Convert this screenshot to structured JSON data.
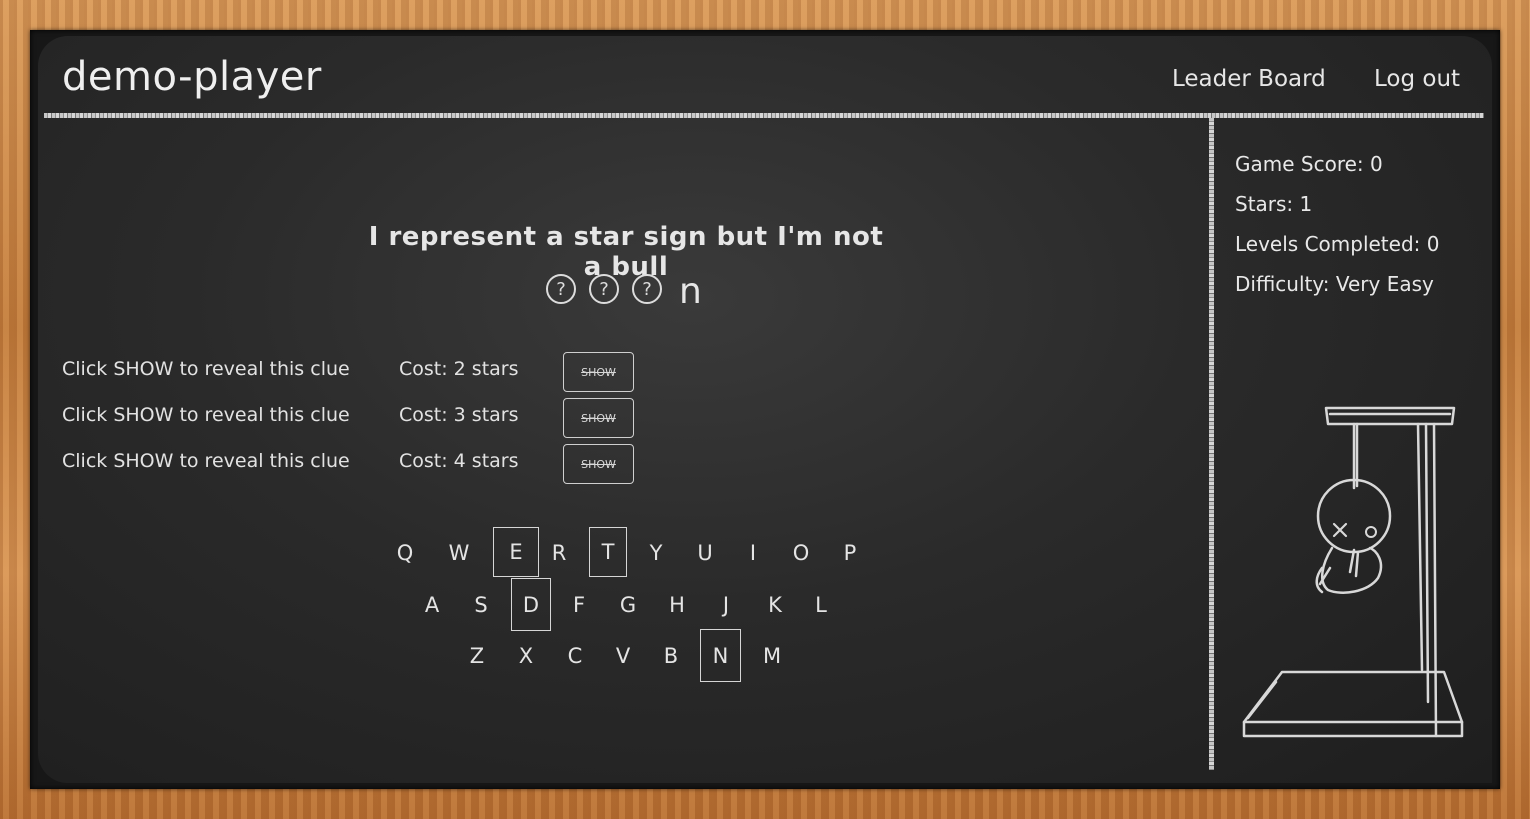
{
  "header": {
    "player": "demo-player",
    "nav": {
      "leaderboard": "Leader Board",
      "logout": "Log out"
    }
  },
  "stats": {
    "score": "Game Score: 0",
    "stars": "Stars: 1",
    "levels": "Levels Completed: 0",
    "difficulty": "Difficulty: Very Easy"
  },
  "puzzle": {
    "clue": "I represent a star sign but I'm not a bull",
    "hidden_mark": "?",
    "revealed_letter": "n"
  },
  "hints": [
    {
      "text": "Click SHOW to reveal this clue",
      "cost": "Cost: 2 stars",
      "button": "SHOW"
    },
    {
      "text": "Click SHOW to reveal this clue",
      "cost": "Cost: 3 stars",
      "button": "SHOW"
    },
    {
      "text": "Click SHOW to reveal this clue",
      "cost": "Cost: 4 stars",
      "button": "SHOW"
    }
  ],
  "keyboard": {
    "row1": [
      "Q",
      "W",
      "E",
      "R",
      "T",
      "Y",
      "U",
      "I",
      "O",
      "P"
    ],
    "row2": [
      "A",
      "S",
      "D",
      "F",
      "G",
      "H",
      "J",
      "K",
      "L"
    ],
    "row3": [
      "Z",
      "X",
      "C",
      "V",
      "B",
      "N",
      "M"
    ],
    "used": [
      "E",
      "T",
      "D",
      "N"
    ]
  },
  "colors": {
    "board": "#2a2a2a",
    "chalk": "#e4e4e4",
    "frame": "#c88547"
  }
}
